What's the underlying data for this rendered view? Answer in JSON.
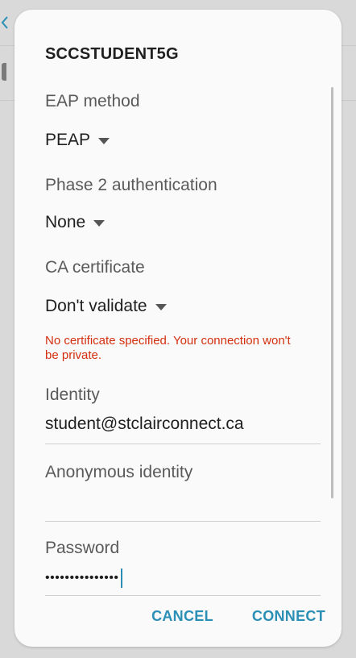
{
  "dialog": {
    "title": "SCCSTUDENT5G",
    "eap_method": {
      "label": "EAP method",
      "value": "PEAP"
    },
    "phase2": {
      "label": "Phase 2 authentication",
      "value": "None"
    },
    "ca_certificate": {
      "label": "CA certificate",
      "value": "Don't validate",
      "warning": "No certificate specified. Your connection won't be private."
    },
    "identity": {
      "label": "Identity",
      "value": "student@stclairconnect.ca"
    },
    "anonymous_identity": {
      "label": "Anonymous identity",
      "value": ""
    },
    "password": {
      "label": "Password",
      "masked_value": "•••••••••••••••"
    },
    "buttons": {
      "cancel": "CANCEL",
      "connect": "CONNECT"
    }
  },
  "colors": {
    "accent": "#2b8fb5",
    "warning": "#d32f0f",
    "dialog_bg": "#fafafa",
    "scrim": "#d9d9d9"
  },
  "icons": {
    "dropdown": "triangle-down-icon",
    "back": "chevron-left-icon"
  }
}
